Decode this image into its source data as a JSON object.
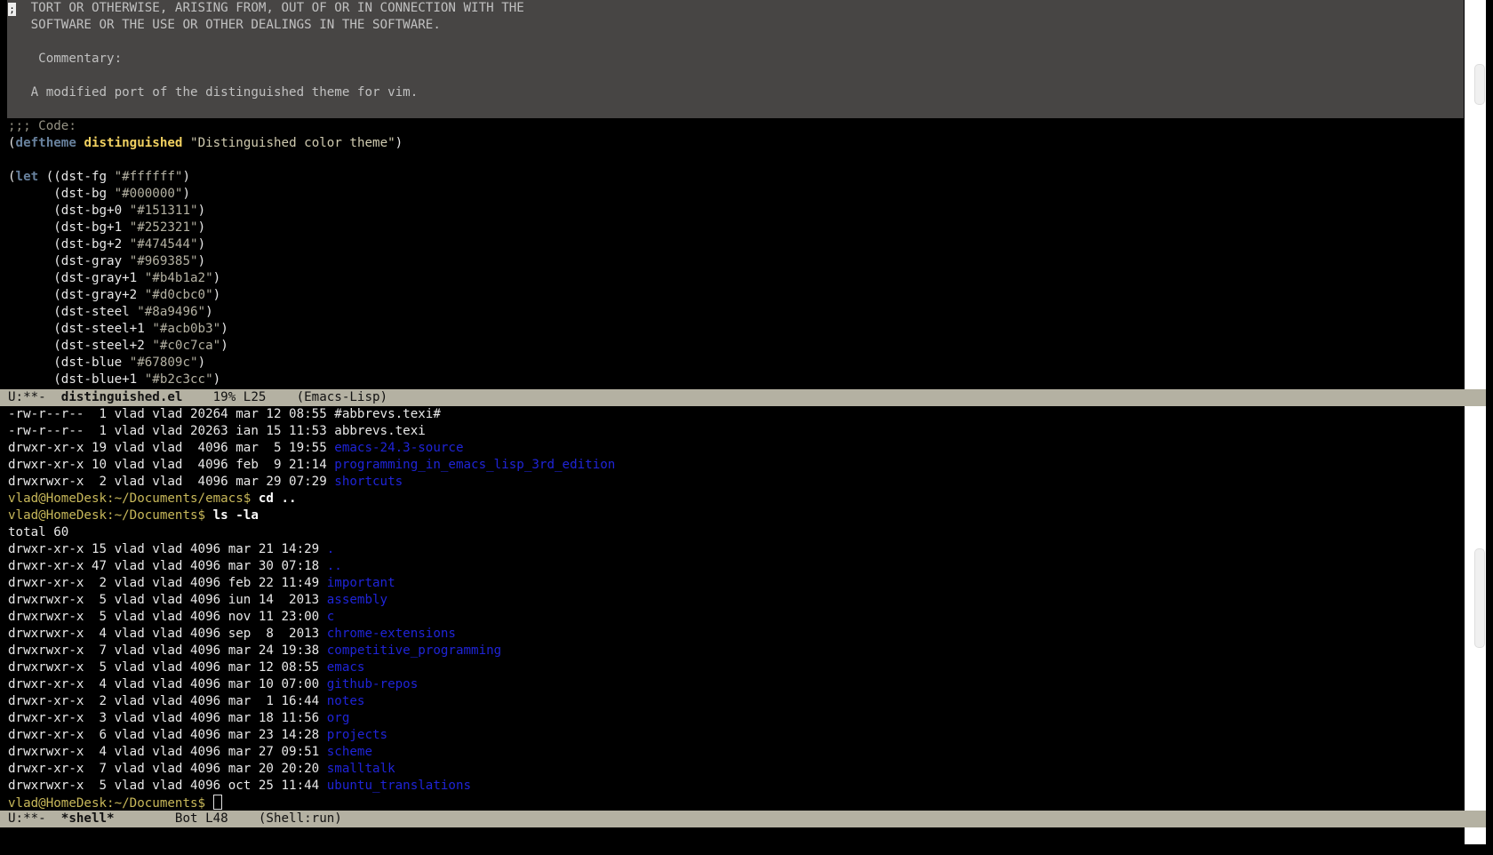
{
  "colors": {
    "background": "#000000",
    "comment_bg": "#474544",
    "modeline_bg": "#b4b1a2",
    "keyword": "#67809c",
    "function_name": "#f0d060",
    "directory": "#1f24d8",
    "prompt": "#c8b85a"
  },
  "top_window": {
    "comment_lines": [
      "   TORT OR OTHERWISE, ARISING FROM, OUT OF OR IN CONNECTION WITH THE",
      "   SOFTWARE OR THE USE OR OTHER DEALINGS IN THE SOFTWARE.",
      "",
      "    Commentary:",
      "",
      "   A modified port of the distinguished theme for vim.",
      ""
    ],
    "code": {
      "code_comment": ";;; Code:",
      "deftheme_kw": "deftheme",
      "theme_name": "distinguished",
      "theme_doc": "\"Distinguished color theme\"",
      "let_kw": "let",
      "bindings": [
        {
          "name": "dst-fg",
          "value": "\"#ffffff\""
        },
        {
          "name": "dst-bg",
          "value": "\"#000000\""
        },
        {
          "name": "dst-bg+0",
          "value": "\"#151311\""
        },
        {
          "name": "dst-bg+1",
          "value": "\"#252321\""
        },
        {
          "name": "dst-bg+2",
          "value": "\"#474544\""
        },
        {
          "name": "dst-gray",
          "value": "\"#969385\""
        },
        {
          "name": "dst-gray+1",
          "value": "\"#b4b1a2\""
        },
        {
          "name": "dst-gray+2",
          "value": "\"#d0cbc0\""
        },
        {
          "name": "dst-steel",
          "value": "\"#8a9496\""
        },
        {
          "name": "dst-steel+1",
          "value": "\"#acb0b3\""
        },
        {
          "name": "dst-steel+2",
          "value": "\"#c0c7ca\""
        },
        {
          "name": "dst-blue",
          "value": "\"#67809c\""
        },
        {
          "name": "dst-blue+1",
          "value": "\"#b2c3cc\""
        }
      ]
    },
    "modeline": {
      "status": "U:**-  ",
      "buffer": "distinguished.el",
      "position": "    19% L25    ",
      "mode": "(Emacs-Lisp)"
    }
  },
  "bottom_window": {
    "pre_listing": [
      {
        "meta": "-rw-r--r--  1 vlad vlad 20264 mar 12 08:55 ",
        "name": "#abbrevs.texi#",
        "dir": false
      },
      {
        "meta": "-rw-r--r--  1 vlad vlad 20263 ian 15 11:53 ",
        "name": "abbrevs.texi",
        "dir": false
      },
      {
        "meta": "drwxr-xr-x 19 vlad vlad  4096 mar  5 19:55 ",
        "name": "emacs-24.3-source",
        "dir": true
      },
      {
        "meta": "drwxr-xr-x 10 vlad vlad  4096 feb  9 21:14 ",
        "name": "programming_in_emacs_lisp_3rd_edition",
        "dir": true
      },
      {
        "meta": "drwxrwxr-x  2 vlad vlad  4096 mar 29 07:29 ",
        "name": "shortcuts",
        "dir": true
      }
    ],
    "commands": [
      {
        "prompt": "vlad@HomeDesk:~/Documents/emacs$ ",
        "cmd": "cd .."
      },
      {
        "prompt": "vlad@HomeDesk:~/Documents$ ",
        "cmd": "ls -la"
      }
    ],
    "total": "total 60",
    "listing": [
      {
        "meta": "drwxr-xr-x 15 vlad vlad 4096 mar 21 14:29 ",
        "name": "."
      },
      {
        "meta": "drwxr-xr-x 47 vlad vlad 4096 mar 30 07:18 ",
        "name": ".."
      },
      {
        "meta": "drwxr-xr-x  2 vlad vlad 4096 feb 22 11:49 ",
        "name": "important"
      },
      {
        "meta": "drwxrwxr-x  5 vlad vlad 4096 iun 14  2013 ",
        "name": "assembly"
      },
      {
        "meta": "drwxrwxr-x  5 vlad vlad 4096 nov 11 23:00 ",
        "name": "c"
      },
      {
        "meta": "drwxrwxr-x  4 vlad vlad 4096 sep  8  2013 ",
        "name": "chrome-extensions"
      },
      {
        "meta": "drwxrwxr-x  7 vlad vlad 4096 mar 24 19:38 ",
        "name": "competitive_programming"
      },
      {
        "meta": "drwxrwxr-x  5 vlad vlad 4096 mar 12 08:55 ",
        "name": "emacs"
      },
      {
        "meta": "drwxr-xr-x  4 vlad vlad 4096 mar 10 07:00 ",
        "name": "github-repos"
      },
      {
        "meta": "drwxr-xr-x  2 vlad vlad 4096 mar  1 16:44 ",
        "name": "notes"
      },
      {
        "meta": "drwxr-xr-x  3 vlad vlad 4096 mar 18 11:56 ",
        "name": "org"
      },
      {
        "meta": "drwxr-xr-x  6 vlad vlad 4096 mar 23 14:28 ",
        "name": "projects"
      },
      {
        "meta": "drwxrwxr-x  4 vlad vlad 4096 mar 27 09:51 ",
        "name": "scheme"
      },
      {
        "meta": "drwxr-xr-x  7 vlad vlad 4096 mar 20 20:20 ",
        "name": "smalltalk"
      },
      {
        "meta": "drwxrwxr-x  5 vlad vlad 4096 oct 25 11:44 ",
        "name": "ubuntu_translations"
      }
    ],
    "final_prompt": "vlad@HomeDesk:~/Documents$ ",
    "modeline": {
      "status": "U:**-  ",
      "buffer": "*shell*",
      "position": "        Bot L48    ",
      "mode": "(Shell:run)"
    }
  }
}
